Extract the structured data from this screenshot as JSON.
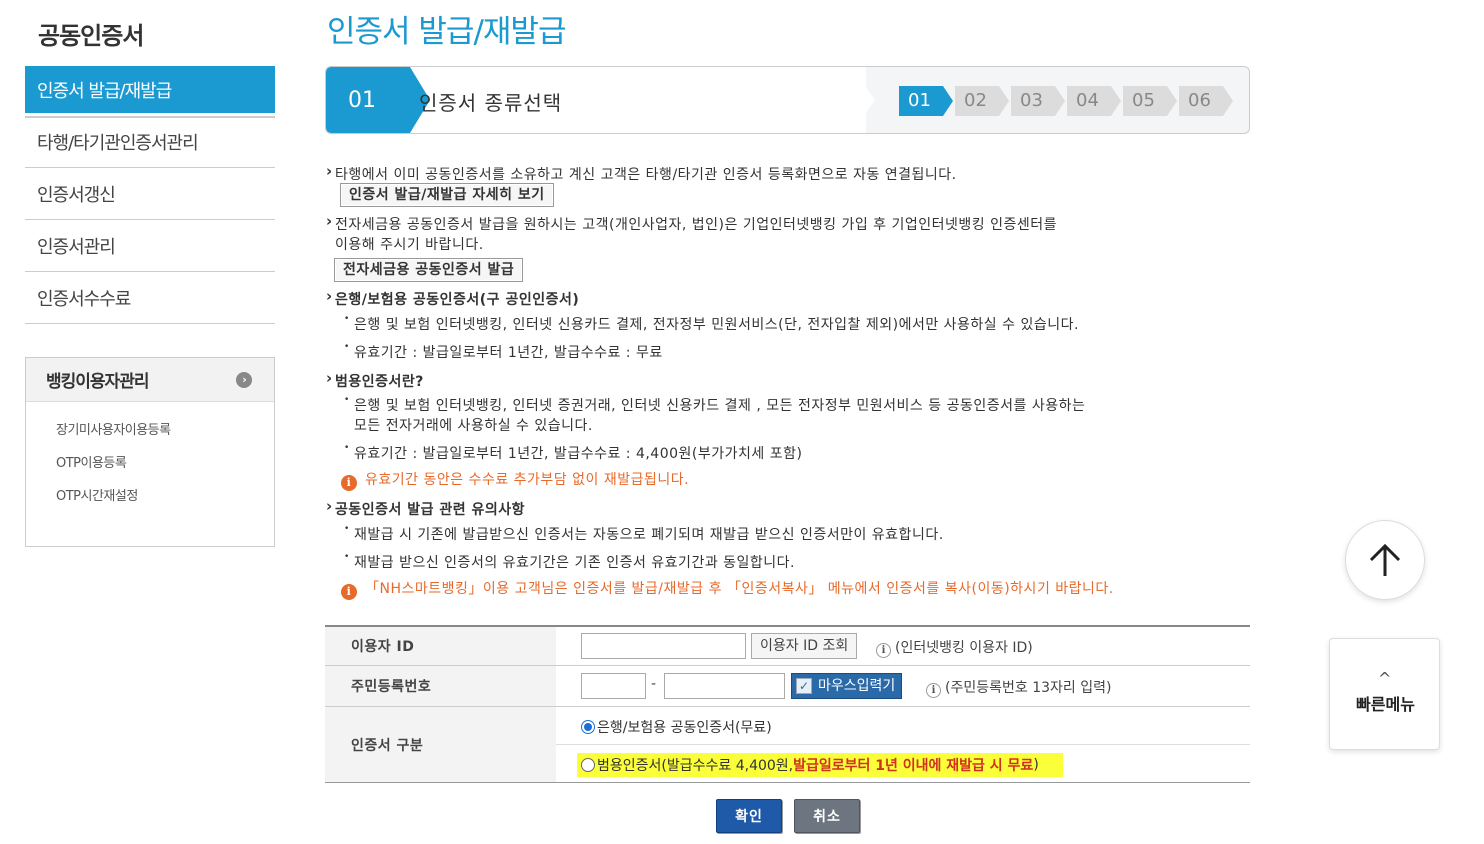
{
  "sidebar": {
    "title": "공동인증서",
    "items": [
      {
        "label": "인증서 발급/재발급"
      },
      {
        "label": "타행/타기관인증서관리"
      },
      {
        "label": "인증서갱신"
      },
      {
        "label": "인증서관리"
      },
      {
        "label": "인증서수수료"
      }
    ],
    "sub_title": "뱅킹이용자관리",
    "sub_items": [
      {
        "label": "장기미사용자이용등록"
      },
      {
        "label": "OTP이용등록"
      },
      {
        "label": "OTP시간재설정"
      }
    ]
  },
  "page": {
    "title": "인증서 발급/재발급"
  },
  "stepbar": {
    "current_number": "01",
    "current_label": "인증서 종류선택",
    "steps": [
      "01",
      "02",
      "03",
      "04",
      "05",
      "06"
    ]
  },
  "content": {
    "p1": "타행에서 이미 공동인증서를 소유하고 계신 고객은 타행/타기관 인증서 등록화면으로 자동 연결됩니다.",
    "btn1": "인증서 발급/재발급 자세히 보기",
    "p2a": "전자세금용 공동인증서 발급을 원하시는 고객(개인사업자, 법인)은 기업인터넷뱅킹 가입 후 기업인터넷뱅킹 인증센터를",
    "p2b": "이용해 주시기 바랍니다.",
    "btn2": "전자세금용 공동인증서 발급",
    "h3": "은행/보험용 공동인증서(구 공인인증서)",
    "s3a": "은행 및 보험 인터넷뱅킹, 인터넷 신용카드 결제, 전자정부 민원서비스(단, 전자입찰 제외)에서만 사용하실 수 있습니다.",
    "s3b": "유효기간 : 발급일로부터 1년간, 발급수수료 : 무료",
    "h4": "범용인증서란?",
    "s4a": "은행 및 보험 인터넷뱅킹, 인터넷 증권거래, 인터넷 신용카드 결제 , 모든 전자정부 민원서비스 등 공동인증서를 사용하는",
    "s4a2": "모든 전자거래에 사용하실 수 있습니다.",
    "s4b": "유효기간 : 발급일로부터 1년간, 발급수수료 : 4,400원(부가가치세 포함)",
    "i4": "유효기간 동안은 수수료 추가부담 없이 재발급됩니다.",
    "h5": "공동인증서 발급 관련 유의사항",
    "s5a": "재발급 시 기존에 발급받으신 인증서는 자동으로 폐기되며 재발급 받으신 인증서만이 유효합니다.",
    "s5b": "재발급 받으신 인증서의 유효기간은 기존 인증서 유효기간과 동일합니다.",
    "i5": "「NH스마트뱅킹」이용 고객님은 인증서를 발급/재발급 후 「인증서복사」 메뉴에서 인증서를 복사(이동)하시기 바랍니다."
  },
  "form": {
    "user_id_label": "이용자 ID",
    "user_id_value": "",
    "user_id_search": "이용자 ID 조회",
    "user_id_hint": "(인터넷뱅킹 이용자 ID)",
    "rrn_label": "주민등록번호",
    "rrn_front": "",
    "rrn_dash": "-",
    "rrn_back": "",
    "mouse_input": "마우스입력기",
    "rrn_hint": "(주민등록번호 13자리 입력)",
    "cert_type_label": "인증서 구분",
    "option1": "은행/보험용 공동인증서(무료)",
    "option2_pre": "범용인증서(발급수수료 4,400원, ",
    "option2_red": "발급일로부터 1년 이내에 재발급 시 무료",
    "option2_post": ")"
  },
  "actions": {
    "confirm": "확인",
    "cancel": "취소"
  },
  "floating": {
    "quick_menu": "빠른메뉴"
  },
  "colors": {
    "accent": "#1b9ad2",
    "warning": "#e86a2a",
    "highlight": "#fbff3a"
  }
}
